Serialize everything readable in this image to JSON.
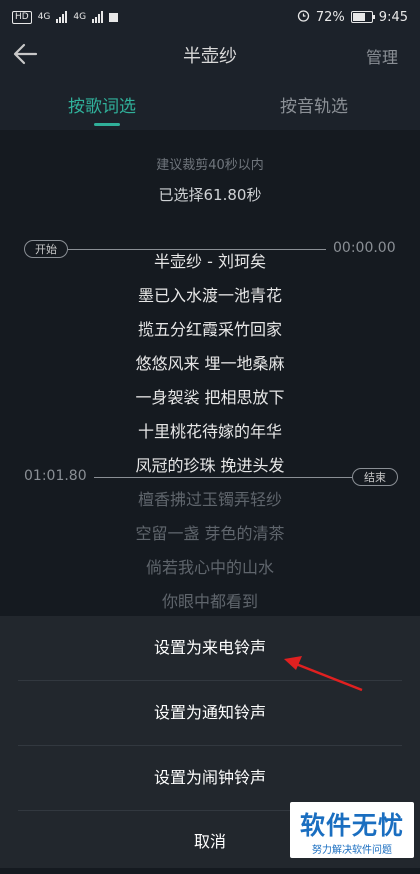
{
  "status_bar": {
    "hd": "HD",
    "net1": "4G",
    "net2": "4G",
    "battery_percent": "72%",
    "battery_level": 0.72,
    "time": "9:45"
  },
  "header": {
    "title": "半壶纱",
    "manage_label": "管理"
  },
  "tabs": [
    {
      "label": "按歌词选",
      "active": true
    },
    {
      "label": "按音轨选",
      "active": false
    }
  ],
  "selection": {
    "hint": "建议裁剪40秒以内",
    "selected": "已选择61.80秒",
    "start_label": "开始",
    "start_time": "00:00.00",
    "end_label": "结束",
    "end_time": "01:01.80"
  },
  "lyrics": [
    {
      "text": "半壶纱 - 刘珂矣",
      "state": "selected"
    },
    {
      "text": "墨已入水渡一池青花",
      "state": "selected"
    },
    {
      "text": "揽五分红霞采竹回家",
      "state": "selected"
    },
    {
      "text": "悠悠风来 埋一地桑麻",
      "state": "selected"
    },
    {
      "text": "一身袈裟 把相思放下",
      "state": "selected"
    },
    {
      "text": "十里桃花待嫁的年华",
      "state": "selected"
    },
    {
      "text": "凤冠的珍珠 挽进头发",
      "state": "selected"
    },
    {
      "text": "檀香拂过玉镯弄轻纱",
      "state": "dim"
    },
    {
      "text": "空留一盏 芽色的清茶",
      "state": "dim"
    },
    {
      "text": "倘若我心中的山水",
      "state": "dim"
    },
    {
      "text": "你眼中都看到",
      "state": "dim"
    }
  ],
  "sheet": {
    "items": [
      "设置为来电铃声",
      "设置为通知铃声",
      "设置为闹钟铃声",
      "取消"
    ]
  },
  "watermark": {
    "main": "软件无忧",
    "sub": "努力解决软件问题"
  },
  "colors": {
    "accent": "#30b09a",
    "annotation_arrow": "#e02020"
  }
}
